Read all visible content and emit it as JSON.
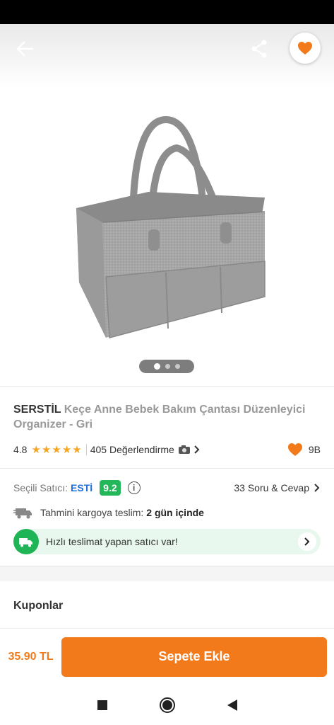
{
  "product": {
    "brand": "SERSTİL",
    "title": " Keçe Anne Bebek Bakım Çantası Düzenleyici Organizer - Gri",
    "rating": "4.8",
    "stars": 5,
    "reviews": "405 Değerlendirme",
    "likes": "9B"
  },
  "seller": {
    "label": "Seçili Satıcı:",
    "name": "ESTİ",
    "score": "9.2",
    "qa": "33 Soru & Cevap"
  },
  "shipping": {
    "label": "Tahmini kargoya teslim:",
    "value": "2 gün içinde",
    "fast_text": "Hızlı teslimat yapan satıcı var!"
  },
  "coupons_label": "Kuponlar",
  "cart": {
    "price": "35.90 TL",
    "button": "Sepete Ekle"
  },
  "gallery": {
    "count": 3,
    "active": 1
  },
  "colors": {
    "accent": "#f27a1a",
    "seller_link": "#1e6fd9",
    "score": "#22b859",
    "fast_bg": "#e8f8ee"
  },
  "icons": [
    "back-arrow-icon",
    "share-icon",
    "heart-icon",
    "camera-icon",
    "chevron-right-icon",
    "info-icon",
    "truck-icon",
    "stop-icon",
    "home-icon",
    "back-triangle-icon"
  ]
}
